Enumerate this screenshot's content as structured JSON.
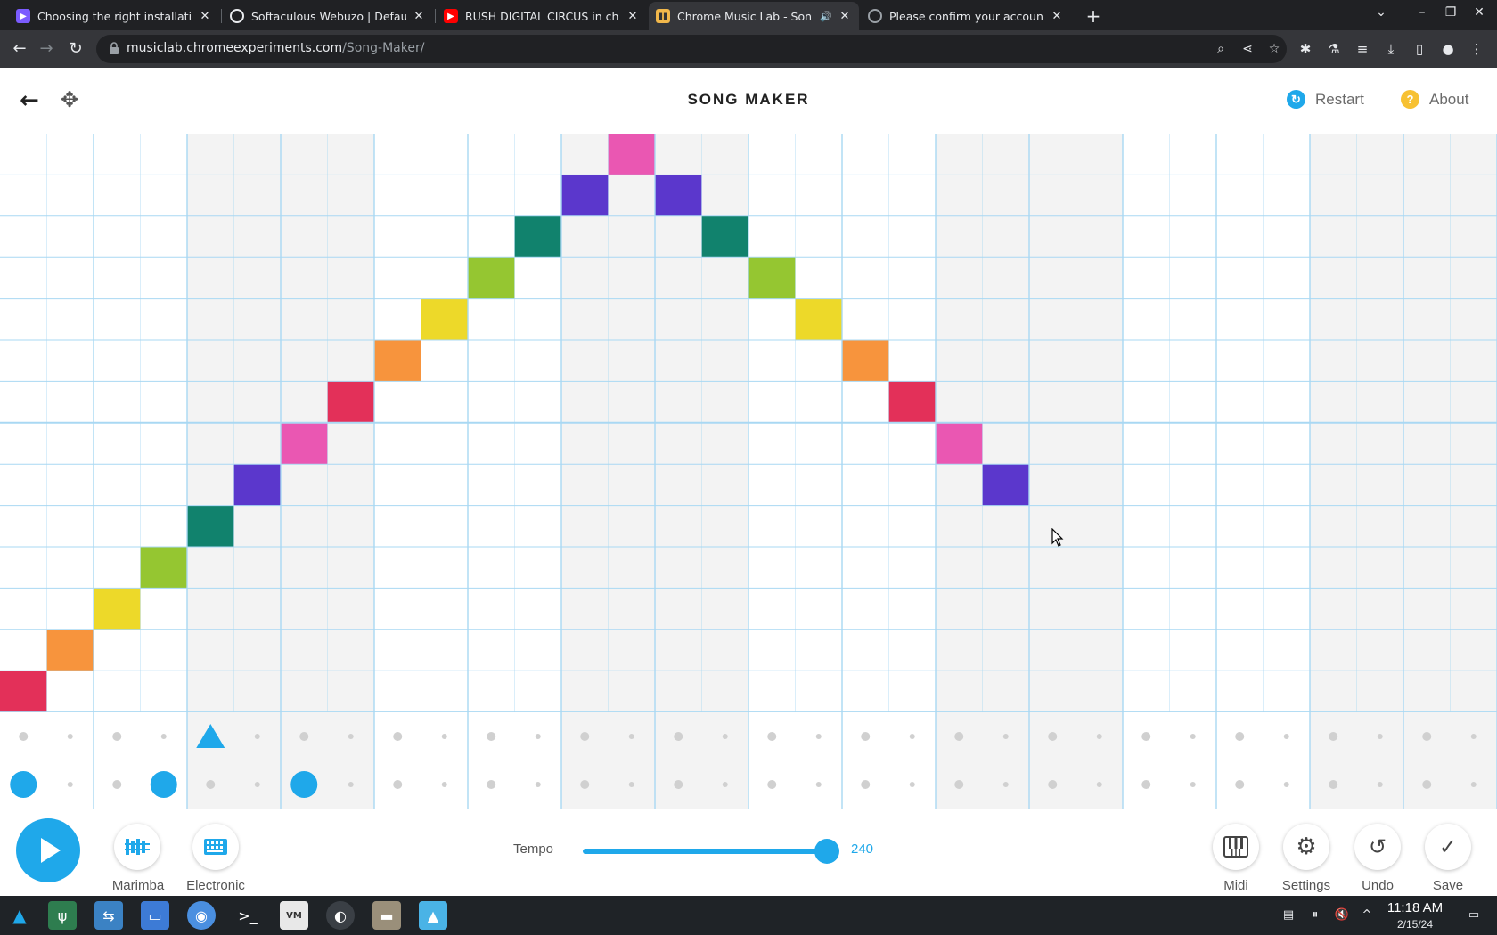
{
  "browser": {
    "tabs": [
      {
        "title": "Choosing the right installatio",
        "favicon": "softaculous-icon",
        "active": false
      },
      {
        "title": "Softaculous Webuzo | Defau",
        "favicon": "globe-icon",
        "active": false
      },
      {
        "title": "RUSH DIGITAL CIRCUS in ch",
        "favicon": "youtube-icon",
        "active": false
      },
      {
        "title": "Chrome Music Lab - Son",
        "favicon": "music-lab-icon",
        "active": true
      },
      {
        "title": "Please confirm your accoun",
        "favicon": "link-icon",
        "active": false
      }
    ],
    "url_host": "musiclab.chromeexperiments.com",
    "url_path": "/Song-Maker/"
  },
  "app": {
    "title": "SONG MAKER",
    "restart_label": "Restart",
    "about_label": "About"
  },
  "grid": {
    "columns": 32,
    "rows": 14,
    "bar_length": 4,
    "octave_divider_row": 7,
    "notes": [
      {
        "col": 0,
        "row": 13,
        "color": "#e33059"
      },
      {
        "col": 1,
        "row": 12,
        "color": "#f7943d"
      },
      {
        "col": 2,
        "row": 11,
        "color": "#edd929"
      },
      {
        "col": 3,
        "row": 10,
        "color": "#95c631"
      },
      {
        "col": 4,
        "row": 9,
        "color": "#11826d"
      },
      {
        "col": 5,
        "row": 8,
        "color": "#5b37cc"
      },
      {
        "col": 6,
        "row": 7,
        "color": "#ea57b2"
      },
      {
        "col": 7,
        "row": 6,
        "color": "#e33059"
      },
      {
        "col": 8,
        "row": 5,
        "color": "#f7943d"
      },
      {
        "col": 9,
        "row": 4,
        "color": "#edd929"
      },
      {
        "col": 10,
        "row": 3,
        "color": "#95c631"
      },
      {
        "col": 11,
        "row": 2,
        "color": "#11826d"
      },
      {
        "col": 12,
        "row": 1,
        "color": "#5b37cc"
      },
      {
        "col": 13,
        "row": 0,
        "color": "#ea57b2"
      },
      {
        "col": 14,
        "row": 1,
        "color": "#5b37cc"
      },
      {
        "col": 15,
        "row": 2,
        "color": "#11826d"
      },
      {
        "col": 16,
        "row": 3,
        "color": "#95c631"
      },
      {
        "col": 17,
        "row": 4,
        "color": "#edd929"
      },
      {
        "col": 18,
        "row": 5,
        "color": "#f7943d"
      },
      {
        "col": 19,
        "row": 6,
        "color": "#e33059"
      },
      {
        "col": 20,
        "row": 7,
        "color": "#ea57b2"
      },
      {
        "col": 21,
        "row": 8,
        "color": "#5b37cc"
      }
    ],
    "rhythm": {
      "triangles": [
        4
      ],
      "circles": [
        0,
        3,
        6
      ]
    },
    "line_color": "#a9d8f3",
    "shade_color": "#f3f3f3",
    "accent": "#1fa8ea"
  },
  "controls": {
    "play": "play-icon",
    "instruments": [
      {
        "label": "Marimba",
        "icon": "marimba-icon"
      },
      {
        "label": "Electronic",
        "icon": "electronic-icon"
      }
    ],
    "tempo_label": "Tempo",
    "tempo_value": "240",
    "tempo_fraction": 0.93,
    "right_buttons": [
      {
        "label": "Midi",
        "icon": "piano-icon"
      },
      {
        "label": "Settings",
        "icon": "gear-icon"
      },
      {
        "label": "Undo",
        "icon": "undo-icon"
      },
      {
        "label": "Save",
        "icon": "check-icon"
      }
    ]
  },
  "taskbar": {
    "time": "11:18 AM",
    "date": "2/15/24"
  }
}
